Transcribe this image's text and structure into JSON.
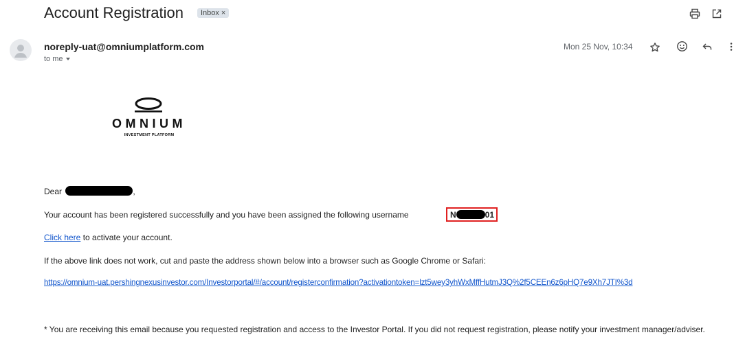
{
  "email": {
    "subject": "Account Registration",
    "label_chip": "Inbox",
    "label_remove": "×",
    "sender": "noreply-uat@omniumplatform.com",
    "recipient": "to me",
    "date": "Mon 25 Nov, 10:34"
  },
  "icons": {
    "print": "printer-icon",
    "new_window": "open-in-new-window-icon",
    "star": "star-icon",
    "emoji": "emoji-icon",
    "reply": "reply-icon",
    "more": "more-vert-icon",
    "avatar": "person-avatar-icon"
  },
  "logo": {
    "name": "OMNIUM",
    "tagline": "INVESTMENT PLATFORM"
  },
  "body": {
    "greeting": "Dear",
    "greeting_end": ",",
    "registered_text": "Your account has been registered successfully and you have been assigned the following username",
    "username_prefix": "N",
    "username_suffix": "01",
    "click_here": "Click here",
    "activate_text": "to activate your account.",
    "fallback_text": "If the above link does not work, cut and paste the address shown below into a browser such as Google Chrome or Safari:",
    "activation_url": "https://omnium-uat.pershingnexusinvestor.com/Investorportal/#/account/registerconfirmation?activationtoken=lzt5wey3yhWxMffHutmJ3Q%2f5CEEn6z6pHQ7e9Xh7JTI%3d",
    "footnote": "* You are receiving this email because you requested registration and access to the Investor Portal. If you did not request registration, please notify your investment manager/adviser."
  },
  "colors": {
    "link": "#1155cc",
    "highlight_box": "#e02020",
    "redaction": "#000000"
  }
}
